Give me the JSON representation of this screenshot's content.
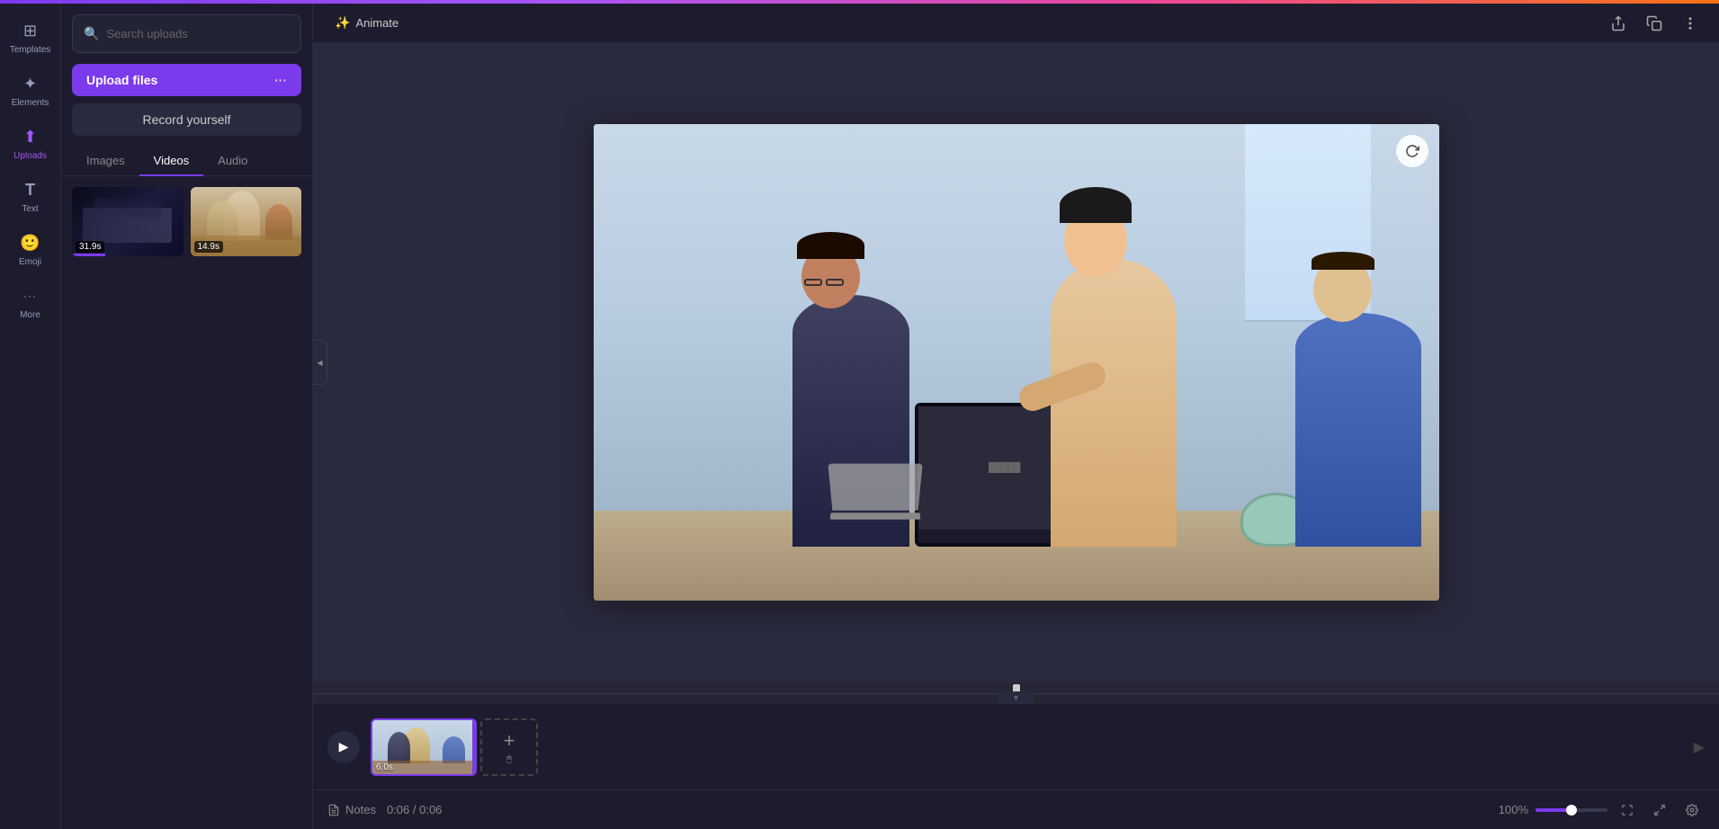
{
  "topbar": {
    "gradient": "linear-gradient(90deg, #7c3aed, #a855f7, #ec4899, #f97316)"
  },
  "sidebar": {
    "items": [
      {
        "id": "templates",
        "label": "Templates",
        "icon": "⊞"
      },
      {
        "id": "elements",
        "label": "Elements",
        "icon": "✦"
      },
      {
        "id": "uploads",
        "label": "Uploads",
        "icon": "⬆"
      },
      {
        "id": "text",
        "label": "Text",
        "icon": "T"
      },
      {
        "id": "emoji",
        "label": "Emoji",
        "icon": "😊"
      },
      {
        "id": "more",
        "label": "More",
        "icon": "···"
      }
    ],
    "active": "uploads"
  },
  "left_panel": {
    "search_placeholder": "Search uploads",
    "upload_btn": "Upload files",
    "upload_more": "···",
    "record_btn": "Record yourself",
    "tabs": [
      {
        "id": "images",
        "label": "Images"
      },
      {
        "id": "videos",
        "label": "Videos",
        "active": true
      },
      {
        "id": "audio",
        "label": "Audio"
      }
    ],
    "media_items": [
      {
        "id": "video1",
        "duration": "31.9s",
        "type": "dark"
      },
      {
        "id": "video2",
        "duration": "14.9s",
        "type": "office"
      }
    ]
  },
  "toolbar": {
    "animate_label": "Animate",
    "icons": [
      "share",
      "duplicate",
      "more"
    ]
  },
  "canvas": {
    "zoom": "100%",
    "time_current": "0:06",
    "time_total": "0:06"
  },
  "timeline": {
    "play_icon": "▶",
    "clips": [
      {
        "id": "clip1",
        "duration": "6.0s"
      }
    ],
    "add_btn": "+",
    "cursor_icon": "🖱"
  },
  "statusbar": {
    "notes_label": "Notes",
    "time_display": "0:06 / 0:06",
    "zoom": "100%"
  }
}
